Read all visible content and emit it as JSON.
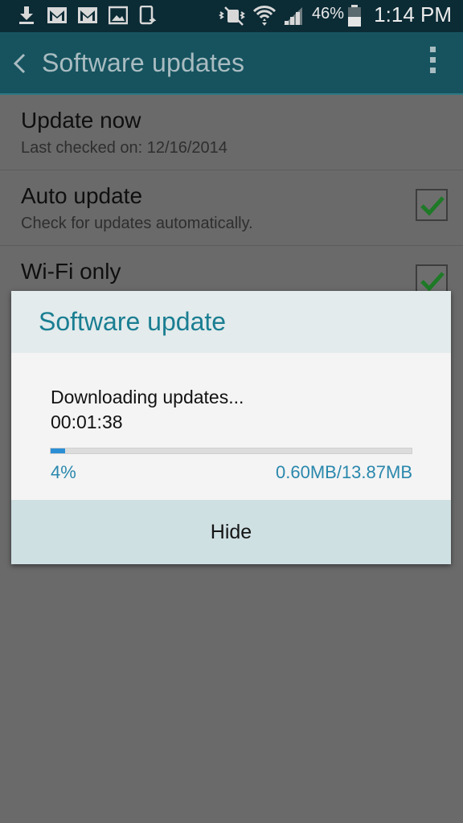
{
  "status_bar": {
    "icons": [
      "download-icon",
      "gmail-icon",
      "gmail-icon",
      "gallery-icon",
      "screenshot-icon",
      "mute-icon",
      "wifi-icon",
      "signal-icon",
      "battery-icon"
    ],
    "battery_percent": "46%",
    "clock": "1:14 PM"
  },
  "action_bar": {
    "title": "Software updates"
  },
  "list": {
    "items": [
      {
        "title": "Update now",
        "subtitle": "Last checked on: 12/16/2014"
      },
      {
        "title": "Auto update",
        "subtitle": "Check for updates automatically.",
        "checked": true
      },
      {
        "title": "Wi-Fi only",
        "checked": true
      }
    ]
  },
  "dialog": {
    "title": "Software update",
    "message": "Downloading updates...",
    "elapsed": "00:01:38",
    "progress_percent": 4,
    "percent_label": "4%",
    "size_label": "0.60MB/13.87MB",
    "button_label": "Hide"
  },
  "colors": {
    "accent": "#1a7e92",
    "progress": "#2c8fd6",
    "action_bar": "#16535f",
    "checkmark": "#1e9a2e"
  }
}
